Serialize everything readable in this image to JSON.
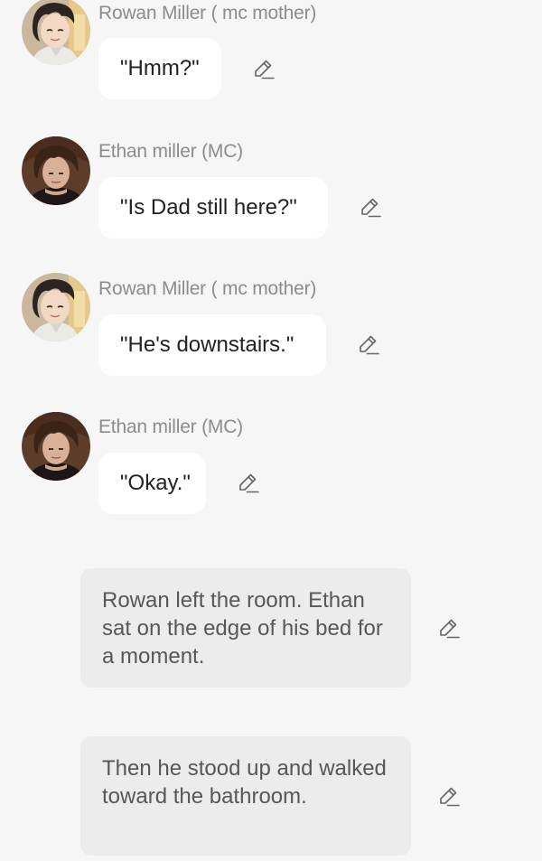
{
  "colors": {
    "background": "#f6f6f6",
    "speaker_name": "#8c8c8c",
    "bubble_bg": "#ffffff",
    "narration_bg": "#ececec",
    "icon": "#666666"
  },
  "messages": [
    {
      "speaker": "Rowan Miller ( mc mother)",
      "text": "\"Hmm?\"",
      "avatar": "rowan-avatar"
    },
    {
      "speaker": "Ethan miller (MC)",
      "text": "\"Is Dad still here?\"",
      "avatar": "ethan-avatar"
    },
    {
      "speaker": "Rowan Miller ( mc mother)",
      "text": "\"He's downstairs.\"",
      "avatar": "rowan-avatar"
    },
    {
      "speaker": "Ethan miller (MC)",
      "text": "\"Okay.\"",
      "avatar": "ethan-avatar"
    }
  ],
  "narrations": [
    {
      "text": "Rowan left the room. Ethan sat on the edge of his bed for a moment."
    },
    {
      "text": "Then he stood up and walked toward the bathroom."
    }
  ],
  "icons": {
    "edit": "pencil-edit-icon"
  }
}
